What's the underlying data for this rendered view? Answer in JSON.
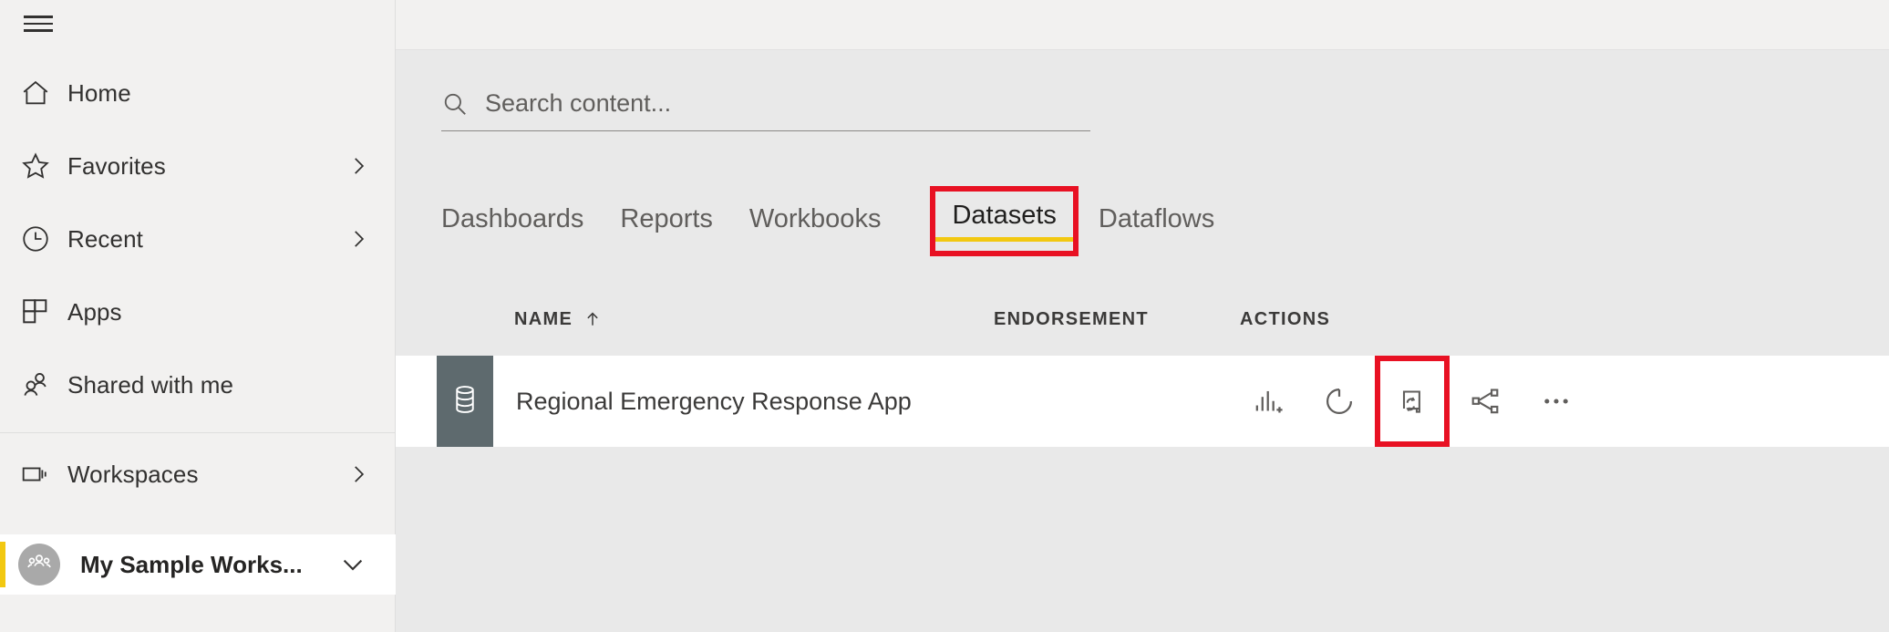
{
  "sidebar": {
    "menu_button": "menu-hamburger",
    "items": [
      {
        "label": "Home",
        "icon": "home-icon",
        "chevron": false
      },
      {
        "label": "Favorites",
        "icon": "star-icon",
        "chevron": true
      },
      {
        "label": "Recent",
        "icon": "clock-icon",
        "chevron": true
      },
      {
        "label": "Apps",
        "icon": "apps-grid-icon",
        "chevron": false
      },
      {
        "label": "Shared with me",
        "icon": "people-icon",
        "chevron": false
      },
      {
        "label": "Workspaces",
        "icon": "workspaces-icon",
        "chevron": true
      }
    ],
    "active_workspace": {
      "label": "My Sample Works...",
      "avatar_icon": "group-avatar-icon",
      "chevron_icon": "chevron-down-icon",
      "accent_color": "#f2c811"
    }
  },
  "search": {
    "placeholder": "Search content...",
    "value": "",
    "icon": "search-icon"
  },
  "tabs": [
    {
      "label": "Dashboards",
      "active": false,
      "highlighted": false
    },
    {
      "label": "Reports",
      "active": false,
      "highlighted": false
    },
    {
      "label": "Workbooks",
      "active": false,
      "highlighted": false
    },
    {
      "label": "Datasets",
      "active": true,
      "highlighted": true
    },
    {
      "label": "Dataflows",
      "active": false,
      "highlighted": false
    }
  ],
  "table": {
    "columns": {
      "name": "NAME",
      "name_sort": "↑",
      "endorsement": "ENDORSEMENT",
      "actions": "ACTIONS"
    },
    "rows": [
      {
        "name": "Regional Emergency Response App",
        "type_icon": "database-icon",
        "endorsement": "",
        "actions": [
          {
            "name": "create-report-icon",
            "highlighted": false
          },
          {
            "name": "refresh-now-icon",
            "highlighted": false
          },
          {
            "name": "schedule-refresh-icon",
            "highlighted": true
          },
          {
            "name": "share-icon",
            "highlighted": false
          },
          {
            "name": "more-options-icon",
            "highlighted": false
          }
        ]
      }
    ]
  },
  "colors": {
    "accent_yellow": "#f2c811",
    "highlight_red": "#e81123",
    "sidebar_bg": "#f2f1f0",
    "main_bg": "#e9e9e9",
    "row_bg": "#ffffff",
    "tile_gray": "#5e6a6e",
    "text_primary": "#323130",
    "text_secondary": "#605e5c"
  }
}
